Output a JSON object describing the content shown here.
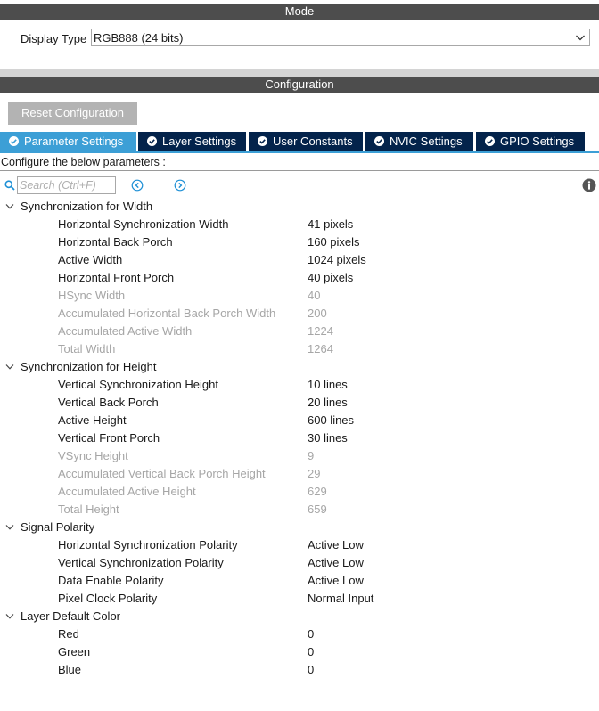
{
  "mode": {
    "header": "Mode",
    "display_type_label": "Display Type",
    "display_type_value": "RGB888 (24 bits)"
  },
  "configuration": {
    "header": "Configuration",
    "reset_label": "Reset Configuration",
    "tabs": [
      {
        "label": "Parameter Settings"
      },
      {
        "label": "Layer Settings"
      },
      {
        "label": "User Constants"
      },
      {
        "label": "NVIC Settings"
      },
      {
        "label": "GPIO Settings"
      }
    ],
    "configure_text": "Configure the below parameters :",
    "search_placeholder": "Search (Ctrl+F)"
  },
  "groups": [
    {
      "label": "Synchronization for Width",
      "params": [
        {
          "label": "Horizontal Synchronization Width",
          "value": "41 pixels",
          "dim": false
        },
        {
          "label": "Horizontal Back Porch",
          "value": "160 pixels",
          "dim": false
        },
        {
          "label": "Active Width",
          "value": "1024 pixels",
          "dim": false
        },
        {
          "label": "Horizontal Front Porch",
          "value": "40 pixels",
          "dim": false
        },
        {
          "label": "HSync Width",
          "value": "40",
          "dim": true
        },
        {
          "label": "Accumulated Horizontal Back Porch Width",
          "value": "200",
          "dim": true
        },
        {
          "label": "Accumulated Active Width",
          "value": "1224",
          "dim": true
        },
        {
          "label": "Total Width",
          "value": "1264",
          "dim": true
        }
      ]
    },
    {
      "label": "Synchronization for Height",
      "params": [
        {
          "label": "Vertical Synchronization Height",
          "value": "10 lines",
          "dim": false
        },
        {
          "label": "Vertical Back Porch",
          "value": "20 lines",
          "dim": false
        },
        {
          "label": "Active Height",
          "value": "600 lines",
          "dim": false
        },
        {
          "label": "Vertical Front Porch",
          "value": "30 lines",
          "dim": false
        },
        {
          "label": "VSync Height",
          "value": "9",
          "dim": true
        },
        {
          "label": "Accumulated Vertical Back Porch Height",
          "value": "29",
          "dim": true
        },
        {
          "label": "Accumulated Active Height",
          "value": "629",
          "dim": true
        },
        {
          "label": "Total Height",
          "value": "659",
          "dim": true
        }
      ]
    },
    {
      "label": "Signal Polarity",
      "params": [
        {
          "label": "Horizontal Synchronization Polarity",
          "value": "Active Low",
          "dim": false
        },
        {
          "label": "Vertical Synchronization Polarity",
          "value": "Active Low",
          "dim": false
        },
        {
          "label": "Data Enable Polarity",
          "value": "Active Low",
          "dim": false
        },
        {
          "label": "Pixel Clock Polarity",
          "value": "Normal Input",
          "dim": false
        }
      ]
    },
    {
      "label": "Layer Default Color",
      "params": [
        {
          "label": "Red",
          "value": "0",
          "dim": false
        },
        {
          "label": "Green",
          "value": "0",
          "dim": false
        },
        {
          "label": "Blue",
          "value": "0",
          "dim": false
        }
      ]
    }
  ],
  "colors": {
    "header_bar": "#4d4d4d",
    "tab_active": "#3c9fd6",
    "tab_inactive": "#03234b",
    "reset_button": "#b3b3b3",
    "dim_text": "#a6a6a6",
    "icon_blue": "#1e90d6"
  },
  "icons": {
    "search": "search-icon",
    "previous": "chevron-left-circle-icon",
    "next": "chevron-right-circle-icon",
    "info": "info-icon",
    "tab_check": "check-circle-icon",
    "dropdown": "chevron-down-icon",
    "group_expand": "chevron-down-icon"
  }
}
